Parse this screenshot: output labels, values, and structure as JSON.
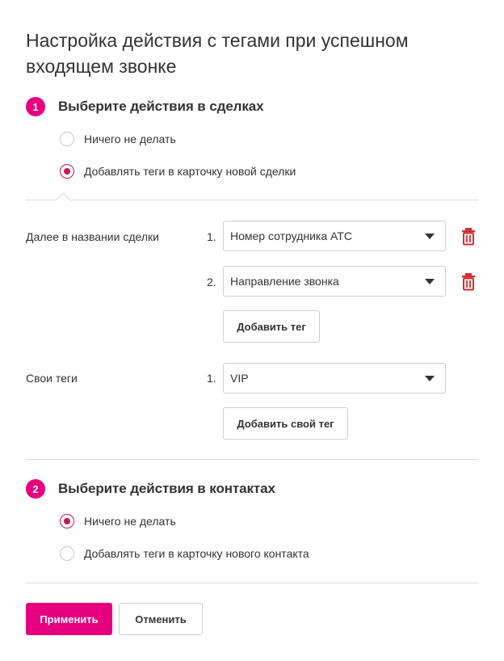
{
  "title": "Настройка действия с тегами при успешном входящем звонке",
  "section1": {
    "number": "1",
    "title": "Выберите действия в сделках",
    "options": [
      {
        "label": "Ничего не делать",
        "checked": false
      },
      {
        "label": "Добавлять теги в карточку новой сделки",
        "checked": true
      }
    ]
  },
  "deal_name_tags": {
    "label": "Далее в названии сделки",
    "items": [
      {
        "num": "1.",
        "value": "Номер сотрудника АТС"
      },
      {
        "num": "2.",
        "value": "Направление звонка"
      }
    ],
    "add_button": "Добавить тег"
  },
  "own_tags": {
    "label": "Свои теги",
    "items": [
      {
        "num": "1.",
        "value": "VIP"
      }
    ],
    "add_button": "Добавить свой тег"
  },
  "section2": {
    "number": "2",
    "title": "Выберите действия в контактах",
    "options": [
      {
        "label": "Ничего не делать",
        "checked": true
      },
      {
        "label": "Добавлять теги в карточку нового контакта",
        "checked": false
      }
    ]
  },
  "footer": {
    "apply": "Применить",
    "cancel": "Отменить"
  },
  "colors": {
    "accent": "#e6007e",
    "radio": "#c2185b",
    "delete_icon": "#d32f2f"
  },
  "icons": {
    "delete": "trash-icon",
    "dropdown": "caret-down-icon"
  }
}
